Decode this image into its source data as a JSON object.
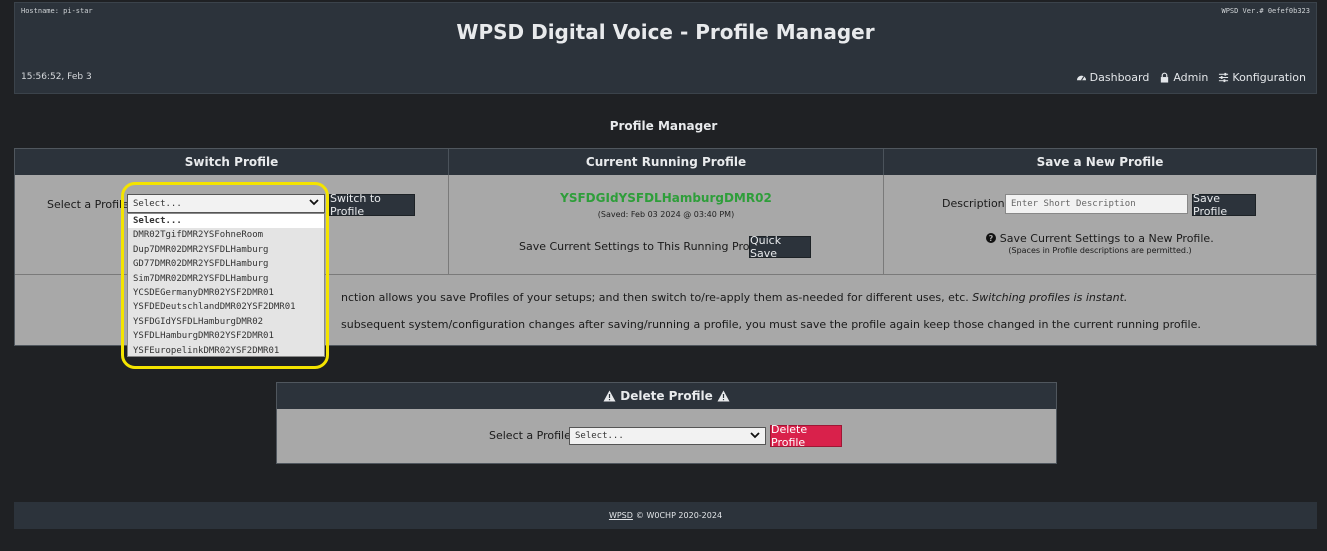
{
  "header": {
    "hostname": "Hostname: pi-star",
    "version": "WPSD Ver.# 0efef0b323",
    "title": "WPSD Digital Voice - Profile Manager",
    "clock": "15:56:52, Feb 3",
    "nav": [
      {
        "label": "Dashboard",
        "icon": "dashboard-icon"
      },
      {
        "label": "Admin",
        "icon": "lock-icon"
      },
      {
        "label": "Konfiguration",
        "icon": "sliders-icon"
      }
    ]
  },
  "section_title": "Profile Manager",
  "switch": {
    "heading": "Switch Profile",
    "label": "Select a Profile:",
    "select_value": "Select...",
    "button": "Switch to Profile",
    "options": [
      "Select...",
      "DMR02TgifDMR2YSFohneRoom",
      "Dup7DMR02DMR2YSFDLHamburg",
      "GD77DMR02DMR2YSFDLHamburg",
      "Sim7DMR02DMR2YSFDLHamburg",
      "YCSDEGermanyDMR02YSF2DMR01",
      "YSFDEDeutschlandDMR02YSF2DMR01",
      "YSFDGIdYSFDLHamburgDMR02",
      "YSFDLHamburgDMR02YSF2DMR01",
      "YSFEuropelinkDMR02YSF2DMR01"
    ]
  },
  "current": {
    "heading": "Current Running Profile",
    "profile_name": "YSFDGIdYSFDLHamburgDMR02",
    "saved": "(Saved: Feb 03 2024 @ 03:40 PM)",
    "quick_save_label": "Save Current Settings to This Running Profile:",
    "quick_save_button": "Quick Save"
  },
  "save_new": {
    "heading": "Save a New Profile",
    "description_label": "Description:",
    "placeholder": "Enter Short Description",
    "button": "Save Profile",
    "hint": "Save Current Settings to a New Profile.",
    "subhint": "(Spaces in Profile descriptions are permitted.)"
  },
  "info": {
    "line1_text": "nction allows you save Profiles of your setups; and then switch to/re-apply them as-needed for different uses, etc. ",
    "line1_em": "Switching profiles is instant.",
    "line2_text": "subsequent system/configuration changes after saving/running a profile, you must save the profile again keep those changed in the current running profile."
  },
  "delete": {
    "heading": "Delete Profile",
    "label": "Select a Profile:",
    "select_value": "Select...",
    "button": "Delete Profile"
  },
  "footer": {
    "link": "WPSD",
    "text": "© W0CHP 2020-2024"
  },
  "colors": {
    "profile_green": "#2e9e3a",
    "delete_red": "#d9214b",
    "highlight_ring": "#f4e400"
  }
}
